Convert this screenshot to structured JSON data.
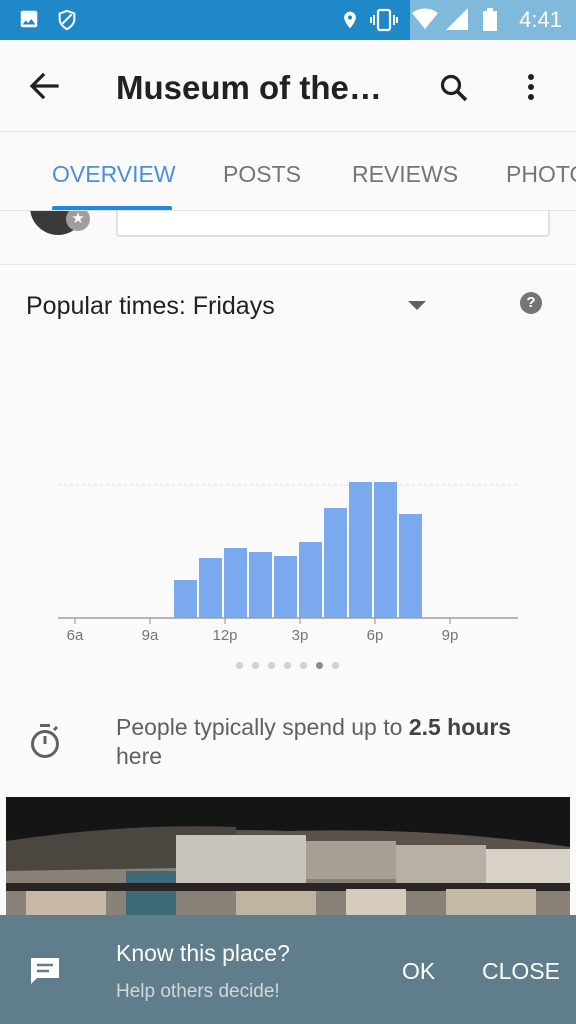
{
  "status_bar": {
    "time": "4:41",
    "icons": [
      "image-icon",
      "vpn-icon",
      "location-icon",
      "vibrate-icon",
      "wifi-icon",
      "signal-icon",
      "battery-icon"
    ]
  },
  "app_bar": {
    "title": "Museum of the…",
    "icons": [
      "back-arrow-icon",
      "search-icon",
      "more-vert-icon"
    ]
  },
  "tabs": [
    {
      "label": "OVERVIEW",
      "active": true
    },
    {
      "label": "POSTS",
      "active": false
    },
    {
      "label": "REVIEWS",
      "active": false
    },
    {
      "label": "PHOTOS",
      "active": false
    }
  ],
  "popular_times": {
    "title": "Popular times: Fridays",
    "dropdown_icon": "arrow-drop-down-icon",
    "help_icon": "help-icon",
    "help_glyph": "?",
    "page_count": 7,
    "active_page": 5
  },
  "chart_data": {
    "type": "bar",
    "x_ticks": [
      "6a",
      "9a",
      "12p",
      "3p",
      "6p",
      "9p"
    ],
    "hours": [
      "10a",
      "11a",
      "12p",
      "1p",
      "2p",
      "3p",
      "4p",
      "5p",
      "6p",
      "7p"
    ],
    "values": [
      19,
      30,
      35,
      33,
      31,
      38,
      55,
      68,
      68,
      52
    ],
    "ylim": [
      0,
      100
    ],
    "grid": "dashed reference line",
    "bar_color": "#7aa9f0"
  },
  "visit_duration": {
    "icon": "timer-icon",
    "prefix": "People typically spend up to ",
    "bold": "2.5 hours",
    "suffix": " here"
  },
  "snackbar": {
    "icon": "chat-icon",
    "title": "Know this place?",
    "subtitle": "Help others decide!",
    "ok_label": "OK",
    "close_label": "CLOSE"
  },
  "colors": {
    "status_bar": "#1e88c9",
    "accent": "#1e88e5",
    "snackbar": "#607d8b"
  }
}
